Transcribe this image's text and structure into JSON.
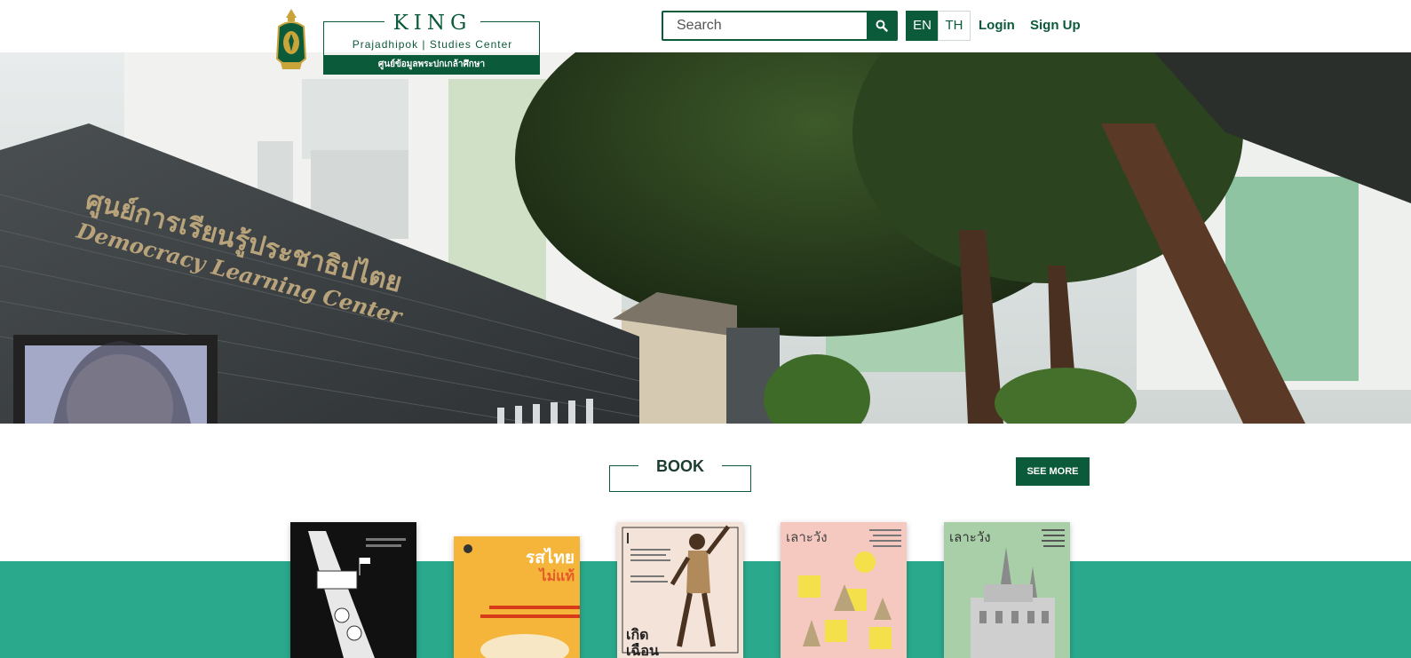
{
  "header": {
    "logo": {
      "king": "KING",
      "subtitle": "Prajadhipok | Studies Center",
      "thai_name": "ศูนย์ข้อมูลพระปกเกล้าศึกษา",
      "crest_icon": "royal-crest-icon"
    },
    "search": {
      "placeholder": "Search",
      "icon": "search-icon"
    },
    "lang": {
      "en": "EN",
      "th": "TH",
      "active": "EN"
    },
    "login": "Login",
    "signup": "Sign Up"
  },
  "hero": {
    "sign_thai": "ศูนย์การเรียนรู้ประชาธิปไตย",
    "sign_en": "Democracy Learning Center"
  },
  "books_section": {
    "title": "BOOK",
    "see_more": "SEE MORE",
    "books": [
      {
        "title": ""
      },
      {
        "title": "รสไทย",
        "title2": "ไม่แท้"
      },
      {
        "title": "เกิด",
        "title2": "เฉือน"
      },
      {
        "title": "เลาะวัง"
      },
      {
        "title": "เลาะวัง"
      }
    ]
  },
  "colors": {
    "brand_green": "#0b5a3a",
    "teal": "#2aa98c",
    "white": "#ffffff"
  }
}
